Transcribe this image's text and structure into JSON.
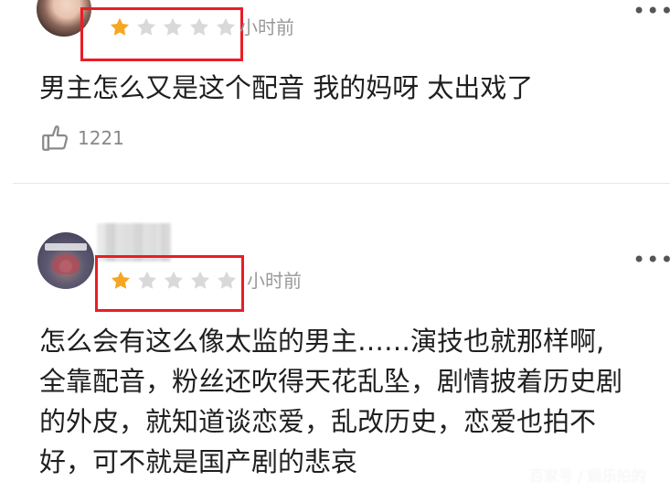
{
  "comments": [
    {
      "time": "小时前",
      "rating": 1,
      "max_rating": 5,
      "text": "男主怎么又是这个配音 我的妈呀 太出戏了",
      "likes": "1221",
      "more_icon": "more-horizontal-icon",
      "like_icon": "thumbs-up-icon"
    },
    {
      "time": "小时前",
      "rating": 1,
      "max_rating": 5,
      "lines": [
        "怎么会有这么像太监的男主……演技也就那样啊,",
        "全靠配音，粉丝还吹得天花乱坠，剧情披着历史剧",
        "的外皮，就知道谈恋爱，乱改历史，恋爱也拍不",
        "好，可不就是国产剧的悲哀"
      ],
      "more_icon": "more-horizontal-icon"
    }
  ],
  "watermark": "百家号 / 娱乐拍的",
  "colors": {
    "star_active": "#f5a623",
    "star_inactive": "#d9d9d9",
    "highlight_box": "#ea1d25",
    "meta_text": "#999999"
  }
}
